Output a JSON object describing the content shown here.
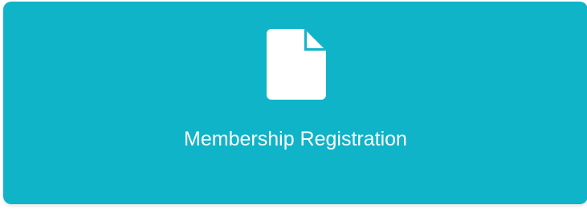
{
  "card": {
    "label": "Membership Registration",
    "icon": "document-icon",
    "background_color": "#0fb4c9",
    "text_color": "#ffffff"
  }
}
